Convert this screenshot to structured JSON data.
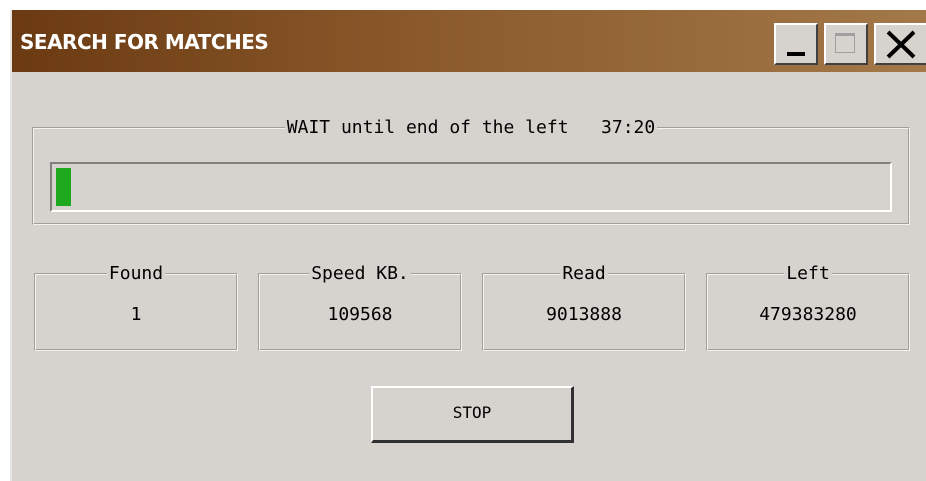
{
  "window": {
    "title": "SEARCH FOR MATCHES",
    "title_bar_color": "#8a5a2c",
    "background_color": "#d6d3ce"
  },
  "titlebar_buttons": {
    "minimize_icon": "minimize-icon",
    "maximize_icon": "maximize-icon",
    "close_icon": "close-icon"
  },
  "progress": {
    "label": "WAIT until end of the left   37:20",
    "fraction": 0.0184,
    "fill_color": "#1ea81e"
  },
  "stats": {
    "found": {
      "label": "Found",
      "value": "1"
    },
    "speed": {
      "label": "Speed KB.",
      "value": "109568"
    },
    "read": {
      "label": "Read",
      "value": "9013888"
    },
    "left": {
      "label": "Left",
      "value": "479383280"
    }
  },
  "actions": {
    "stop_label": "STOP"
  }
}
